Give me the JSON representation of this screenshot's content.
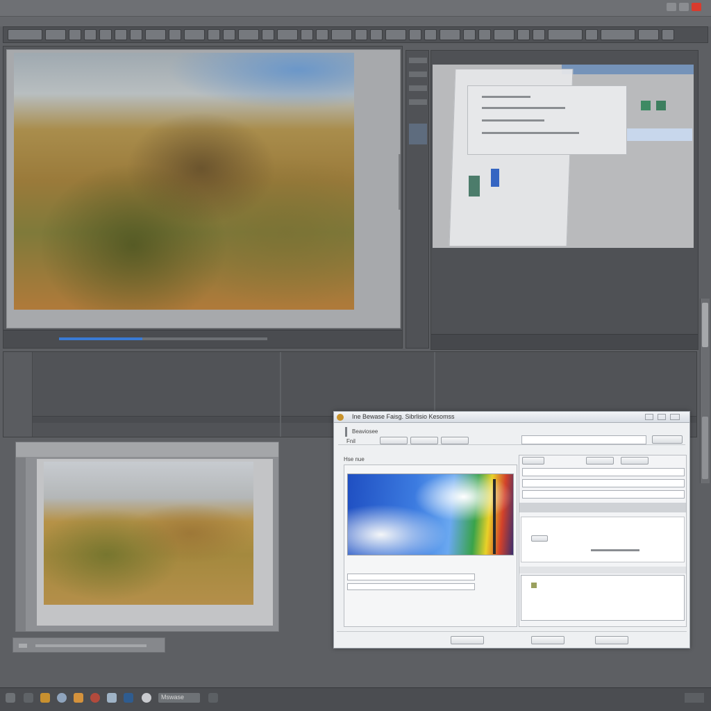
{
  "window": {
    "title": "",
    "close_color": "#d83b2e"
  },
  "dialog": {
    "title": "Ine Bewase Faisg. Sibrlisio Kesomss",
    "menu": [
      "Beaviosee",
      "Fnil"
    ],
    "tab": "Hse nue",
    "fields": {
      "top_input_value": "",
      "right_input_value": ""
    },
    "buttons": {
      "ok": "",
      "cancel": "",
      "apply": ""
    }
  },
  "taskbar": {
    "label": "Mswase"
  },
  "icons": {
    "app": "app-icon",
    "folder": "folder-icon",
    "browser": "browser-icon",
    "settings": "gear-icon"
  }
}
